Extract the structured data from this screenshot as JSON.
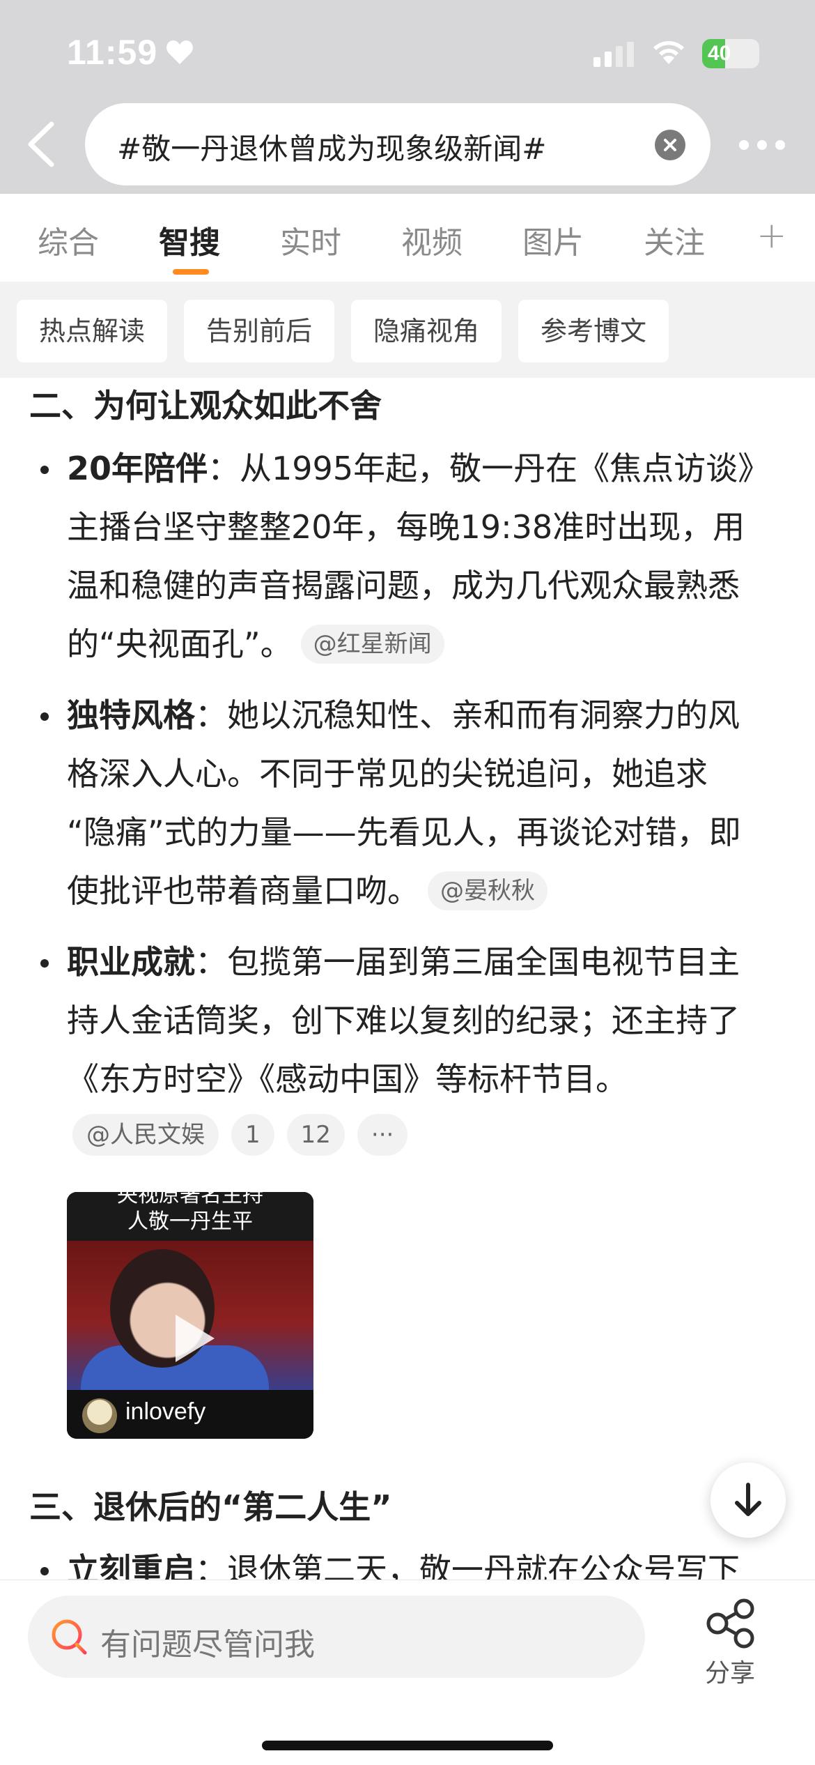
{
  "status": {
    "time": "11:59",
    "battery": "40"
  },
  "search": {
    "query": "#敬一丹退休曾成为现象级新闻#"
  },
  "tabs": [
    {
      "label": "综合"
    },
    {
      "label": "智搜"
    },
    {
      "label": "实时"
    },
    {
      "label": "视频"
    },
    {
      "label": "图片"
    },
    {
      "label": "关注"
    }
  ],
  "tab_plus": "+",
  "chips": [
    "热点解读",
    "告别前后",
    "隐痛视角",
    "参考博文"
  ],
  "section2": {
    "title": "二、为何让观众如此不舍",
    "items": [
      {
        "head": "20年陪伴",
        "lines": [
          "：从1995年起，敬一丹在《焦点访谈》",
          "主播台坚守整整20年，每晚19:38准时出现，用",
          "温和稳健的声音揭露问题，成为几代观众最熟悉",
          "的“央视面孔”。"
        ],
        "source": "@红星新闻"
      },
      {
        "head": "独特风格",
        "lines": [
          "：她以沉稳知性、亲和而有洞察力的风",
          "格深入人心。不同于常见的尖锐追问，她追求",
          "“隐痛”式的力量——先看见人，再谈论对错，即",
          "使批评也带着商量口吻。"
        ],
        "source": "@晏秋秋"
      },
      {
        "head": "职业成就",
        "lines": [
          "：包揽第一届到第三届全国电视节目主",
          "持人金话筒奖，创下难以复刻的纪录；还主持了",
          "《东方时空》《感动中国》等标杆节目。"
        ],
        "source": ""
      }
    ],
    "meta": [
      "@人民文娱",
      "1",
      "12",
      "···"
    ]
  },
  "video": {
    "caption_line1": "央视原著名主持",
    "caption_line2": "人敬一丹生平",
    "user": "inlovefy"
  },
  "section3": {
    "title": "三、退休后的“第二人生”",
    "item_head": "立刻重启",
    "item_text": "：退休第二天，敬一丹就在公众号写下"
  },
  "bottom": {
    "ask_placeholder": "有问题尽管问我",
    "share_label": "分享"
  },
  "colors": {
    "accent": "#ff8a1f",
    "top_bg": "#d7d7d9",
    "chip_bg": "#f2f2f2"
  }
}
